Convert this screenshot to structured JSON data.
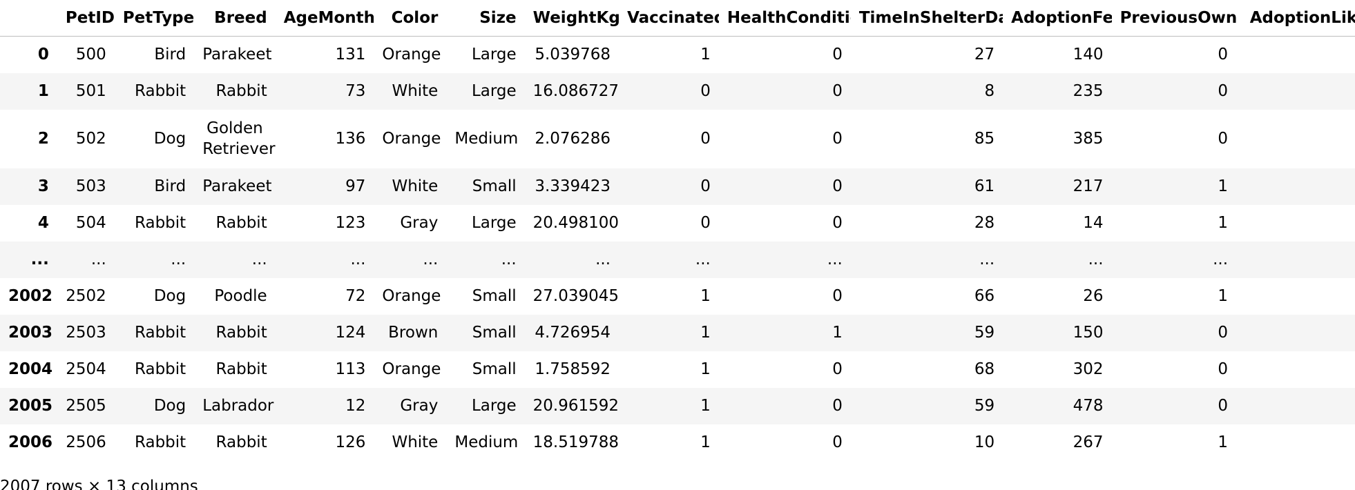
{
  "table": {
    "columns": [
      "",
      "PetID",
      "PetType",
      "Breed",
      "AgeMonths",
      "Color",
      "Size",
      "WeightKg",
      "Vaccinated",
      "HealthCondition",
      "TimeInShelterDays",
      "AdoptionFee",
      "PreviousOwner",
      "AdoptionLikel"
    ],
    "rows": [
      {
        "index": "0",
        "cells": [
          "500",
          "Bird",
          "Parakeet",
          "131",
          "Orange",
          "Large",
          "5.039768",
          "1",
          "0",
          "27",
          "140",
          "0",
          ""
        ]
      },
      {
        "index": "1",
        "cells": [
          "501",
          "Rabbit",
          "Rabbit",
          "73",
          "White",
          "Large",
          "16.086727",
          "0",
          "0",
          "8",
          "235",
          "0",
          ""
        ]
      },
      {
        "index": "2",
        "cells": [
          "502",
          "Dog",
          "Golden Retriever",
          "136",
          "Orange",
          "Medium",
          "2.076286",
          "0",
          "0",
          "85",
          "385",
          "0",
          ""
        ]
      },
      {
        "index": "3",
        "cells": [
          "503",
          "Bird",
          "Parakeet",
          "97",
          "White",
          "Small",
          "3.339423",
          "0",
          "0",
          "61",
          "217",
          "1",
          ""
        ]
      },
      {
        "index": "4",
        "cells": [
          "504",
          "Rabbit",
          "Rabbit",
          "123",
          "Gray",
          "Large",
          "20.498100",
          "0",
          "0",
          "28",
          "14",
          "1",
          ""
        ]
      },
      {
        "index": "...",
        "cells": [
          "...",
          "...",
          "...",
          "...",
          "...",
          "...",
          "...",
          "...",
          "...",
          "...",
          "...",
          "...",
          ""
        ]
      },
      {
        "index": "2002",
        "cells": [
          "2502",
          "Dog",
          "Poodle",
          "72",
          "Orange",
          "Small",
          "27.039045",
          "1",
          "0",
          "66",
          "26",
          "1",
          ""
        ]
      },
      {
        "index": "2003",
        "cells": [
          "2503",
          "Rabbit",
          "Rabbit",
          "124",
          "Brown",
          "Small",
          "4.726954",
          "1",
          "1",
          "59",
          "150",
          "0",
          ""
        ]
      },
      {
        "index": "2004",
        "cells": [
          "2504",
          "Rabbit",
          "Rabbit",
          "113",
          "Orange",
          "Small",
          "1.758592",
          "1",
          "0",
          "68",
          "302",
          "0",
          ""
        ]
      },
      {
        "index": "2005",
        "cells": [
          "2505",
          "Dog",
          "Labrador",
          "12",
          "Gray",
          "Large",
          "20.961592",
          "1",
          "0",
          "59",
          "478",
          "0",
          ""
        ]
      },
      {
        "index": "2006",
        "cells": [
          "2506",
          "Rabbit",
          "Rabbit",
          "126",
          "White",
          "Medium",
          "18.519788",
          "1",
          "0",
          "10",
          "267",
          "1",
          ""
        ]
      }
    ]
  },
  "footer": {
    "shape_text": "2007 rows × 13 columns"
  }
}
